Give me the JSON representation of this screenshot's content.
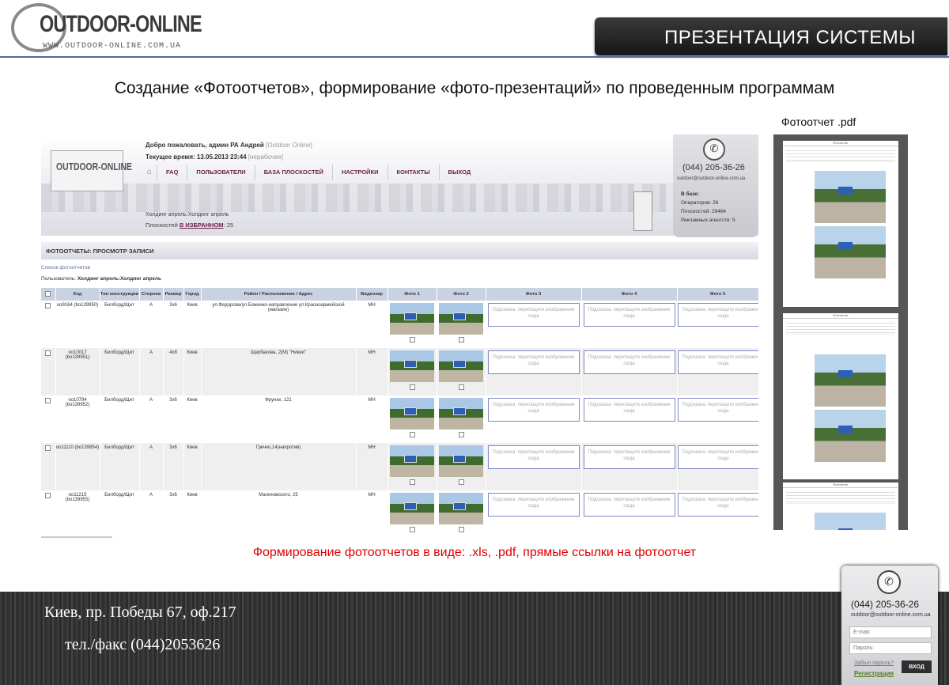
{
  "header": {
    "logo_text": "OUTDOOR-ONLINE",
    "logo_url": "WWW.OUTDOOR-ONLINE.COM.UA",
    "banner_title": "ПРЕЗЕНТАЦИЯ СИСТЕМЫ"
  },
  "heading": "Создание «Фотоотчетов», формирование «фото-презентаций» по проведенным программам",
  "app": {
    "welcome": "Добро пожаловать, админ РА Андрей",
    "welcome_tag": "[Outdoor Online]",
    "time_label": "Текущее время: 13.05.2013 23:44",
    "time_tag": "[нерабочее]",
    "menu": [
      "FAQ",
      "ПОЛЬЗОВАТЕЛИ",
      "БАЗА ПЛОСКОСТЕЙ",
      "НАСТРОЙКИ",
      "КОНТАКТЫ",
      "ВЫХОД"
    ],
    "holding": "Холдинг апрель:Холдинг апрель",
    "fav_prefix": "Плоскостей",
    "fav_link": "В ИЗБРАННОМ",
    "fav_count": ": 25",
    "contact": {
      "phone": "(044) 205-36-26",
      "email": "outdoor@outdoor-online.com.ua",
      "base_label": "В базе:",
      "operators": "Операторов:  26",
      "planes": "Плоскостей:  29464",
      "agencies": "Рекламных агентств:  5"
    },
    "section_title": "ФОТООТЧЕТЫ: ПРОСМОТР ЗАПИСИ",
    "breadcrumb": "Список фотоотчетов",
    "user_line_label": "Пользователь:",
    "user_line_value": "Холдинг апрель:Холдинг апрель",
    "columns": [
      "",
      "Код",
      "Тип конструкции",
      "Сторона",
      "Размер",
      "Город",
      "Район / Расположение / Адрес",
      "Видеоэкр",
      "Фото 1",
      "Фото 2",
      "Фото 3",
      "Фото 4",
      "Фото 5"
    ],
    "drop_hint": "Подсказка: перетащите изображение сюда",
    "rows": [
      {
        "code": "oo9164 (bo139950)",
        "type": "Билборд/Щит",
        "side": "A",
        "size": "3x6",
        "city": "Киев",
        "address": "ул.Федорова/ул.Боженко-направление ул.Красноармейской (магазин)",
        "media": "МН"
      },
      {
        "code": "oo10017 (bo139951)",
        "type": "Билборд/Щит",
        "side": "A",
        "size": "4x8",
        "city": "Киев",
        "address": "Щербакова, 2(М) \"Нивки\"",
        "media": "МН"
      },
      {
        "code": "oo10794 (bo139952)",
        "type": "Билборд/Щит",
        "side": "A",
        "size": "3x6",
        "city": "Киев",
        "address": "Фрунзе, 121",
        "media": "МН"
      },
      {
        "code": "oo11110 (bo139954)",
        "type": "Билборд/Щит",
        "side": "A",
        "size": "3x6",
        "city": "Киев",
        "address": "Гречко,14(напротив)",
        "media": "МН"
      },
      {
        "code": "oo11215 (bo139955)",
        "type": "Билборд/Щит",
        "side": "A",
        "size": "3x6",
        "city": "Киев",
        "address": "Малиновского, 25",
        "media": "МН"
      }
    ]
  },
  "pdf_caption": "Фотоотчет  .pdf",
  "pdf_pages": [
    {
      "title": "Фотоотчет"
    },
    {
      "title": "Фотоотчет"
    },
    {
      "title": "Фотоотчет"
    }
  ],
  "note": "Формирование  фотоотчетов в виде: .xls, .pdf, прямые ссылки на фотоотчет",
  "footer": {
    "address": "Киев, пр. Победы 67, оф.217",
    "phone": "тел./факс  (044)2053626"
  },
  "login": {
    "phone": "(044) 205-36-26",
    "email": "outdoor@outdoor-online.com.ua",
    "email_placeholder": "E-mail:",
    "password_placeholder": "Пароль:",
    "forgot": "Забыл пароль?",
    "register": "Регистрация",
    "submit": "ВХОД"
  },
  "colors": {
    "accent_menu": "#6b1f44",
    "note_red": "#e00000",
    "header_line": "#4a6f9a",
    "table_header": "#c9d2e3"
  }
}
